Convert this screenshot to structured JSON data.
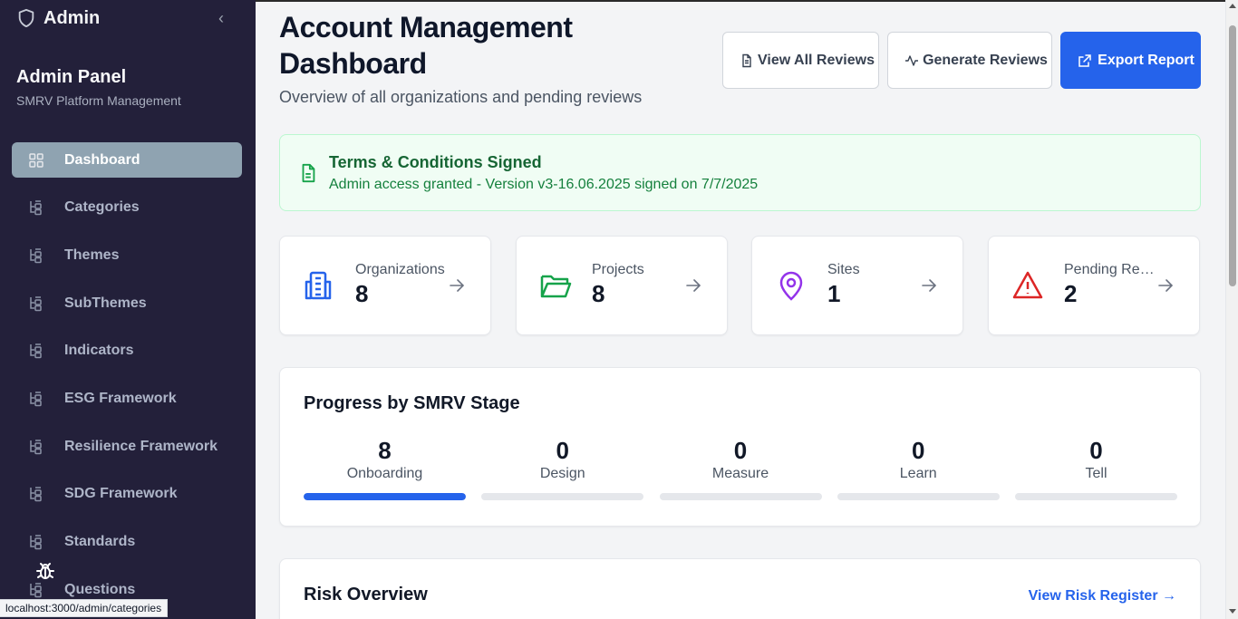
{
  "sidebar": {
    "brand": "Admin",
    "panel_title": "Admin Panel",
    "panel_subtitle": "SMRV Platform Management",
    "items": [
      {
        "label": "Dashboard",
        "icon": "dashboard-grid-icon",
        "active": true
      },
      {
        "label": "Categories",
        "icon": "tree-icon"
      },
      {
        "label": "Themes",
        "icon": "tree-icon"
      },
      {
        "label": "SubThemes",
        "icon": "tree-icon"
      },
      {
        "label": "Indicators",
        "icon": "tree-icon"
      },
      {
        "label": "ESG Framework",
        "icon": "tree-icon"
      },
      {
        "label": "Resilience Framework",
        "icon": "tree-icon"
      },
      {
        "label": "SDG Framework",
        "icon": "tree-icon"
      },
      {
        "label": "Standards",
        "icon": "tree-icon"
      },
      {
        "label": "Questions",
        "icon": "tree-icon"
      }
    ]
  },
  "status_url": "localhost:3000/admin/categories",
  "header": {
    "title": "Account Management Dashboard",
    "subtitle": "Overview of all organizations and pending reviews",
    "buttons": {
      "view_reviews": "View All Reviews",
      "generate_reviews": "Generate Reviews",
      "export_report": "Export Report"
    }
  },
  "terms": {
    "title": "Terms & Conditions Signed",
    "description": "Admin access granted - Version v3-16.06.2025 signed on 7/7/2025"
  },
  "stats": [
    {
      "label": "Organizations",
      "value": "8",
      "icon": "building-icon",
      "color": "#2563eb"
    },
    {
      "label": "Projects",
      "value": "8",
      "icon": "folder-open-icon",
      "color": "#16a34a"
    },
    {
      "label": "Sites",
      "value": "1",
      "icon": "map-pin-icon",
      "color": "#9333ea"
    },
    {
      "label": "Pending Reviews",
      "value": "2",
      "icon": "alert-triangle-icon",
      "color": "#dc2626"
    }
  ],
  "progress": {
    "title": "Progress by SMRV Stage",
    "stages": [
      {
        "name": "Onboarding",
        "value": "8",
        "fill": 1.0
      },
      {
        "name": "Design",
        "value": "0",
        "fill": 0
      },
      {
        "name": "Measure",
        "value": "0",
        "fill": 0
      },
      {
        "name": "Learn",
        "value": "0",
        "fill": 0
      },
      {
        "name": "Tell",
        "value": "0",
        "fill": 0
      }
    ]
  },
  "risk": {
    "title": "Risk Overview",
    "link": "View Risk Register →"
  },
  "colors": {
    "sidebar_bg": "#23203a",
    "accent": "#2563eb",
    "active_nav": "#8fa3b1"
  }
}
